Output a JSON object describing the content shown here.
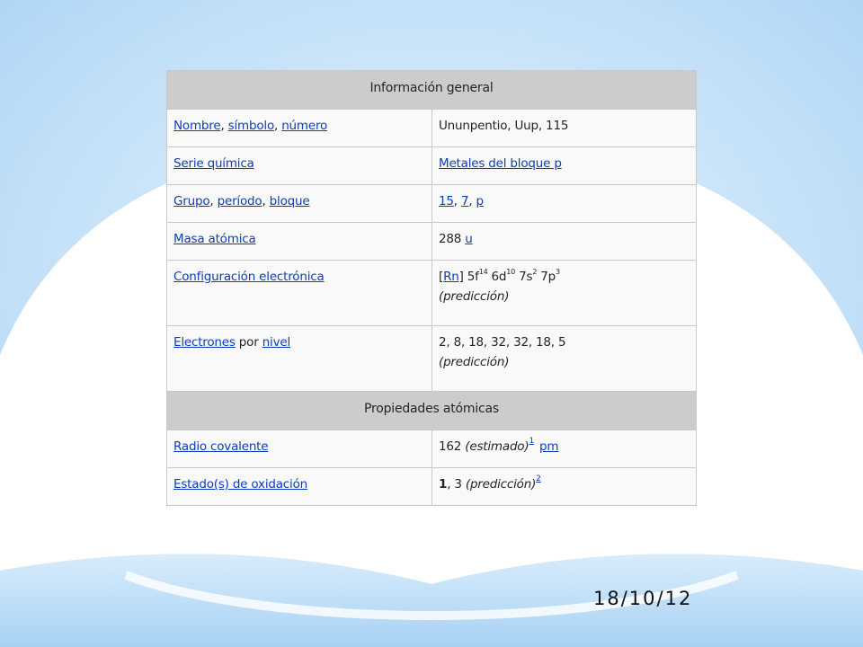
{
  "slide": {
    "date": "18/10/12",
    "colors": {
      "sky": "#a8d2f4",
      "highlight": "#ffffff",
      "section_bg": "#cccccc",
      "link": "#0b3ebc"
    }
  },
  "infobox": {
    "general_header": "Información general",
    "rows": {
      "name": {
        "label_1": "Nombre",
        "sep_1": ", ",
        "label_2": "símbolo",
        "sep_2": ", ",
        "label_3": "número",
        "value": "Ununpentio, Uup, 115"
      },
      "series": {
        "label": "Serie química",
        "value": "Metales del bloque p"
      },
      "group": {
        "label_1": "Grupo",
        "sep_1": ", ",
        "label_2": "período",
        "sep_2": ", ",
        "label_3": "bloque",
        "v1": "15",
        "vsep_1": ", ",
        "v2": "7",
        "vsep_2": ", ",
        "v3": "p"
      },
      "mass": {
        "label": "Masa atómica",
        "number": "288 ",
        "unit": "u"
      },
      "config": {
        "label": "Configuración electrónica",
        "open": "[",
        "core": "Rn",
        "close": "] ",
        "o1": "5f",
        "e1": "14",
        "o2": "6d",
        "e2": "10",
        "o3": "7s",
        "e3": "2",
        "o4": "7p",
        "e4": "3",
        "note": "(predicción)"
      },
      "electrons": {
        "label_1": "Electrones",
        "mid": " por ",
        "label_2": "nivel",
        "value": "2, 8, 18, 32, 32, 18, 5",
        "note": "(predicción)"
      }
    },
    "atomic_header": "Propiedades atómicas",
    "atomic_rows": {
      "radius": {
        "label": "Radio covalente",
        "number": "162 ",
        "note": "(estimado)",
        "ref": "1",
        "unit": "pm"
      },
      "oxidation": {
        "label": "Estado(s) de oxidación",
        "bold_value": "1",
        "rest": ", 3 ",
        "note": "(predicción)",
        "ref": "2"
      }
    }
  }
}
